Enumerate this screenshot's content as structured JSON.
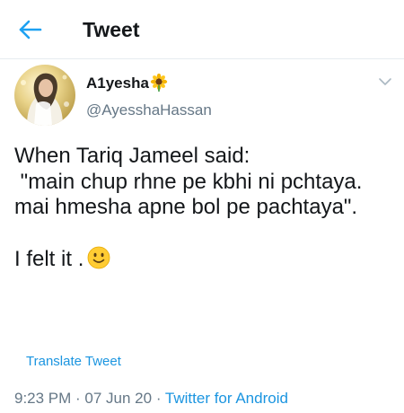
{
  "header": {
    "title": "Tweet",
    "back_icon": "arrow-left-icon",
    "accent": "#1da1f2"
  },
  "author": {
    "display_name": "A1yesha",
    "name_emoji": "sunflower-emoji",
    "handle": "@AyesshaHassan",
    "caret_icon": "chevron-down-icon"
  },
  "tweet": {
    "line1": "When Tariq Jameel said:",
    "line2": " \"main chup rhne pe kbhi ni pchtaya. mai hmesha apne bol pe pachtaya\".",
    "line3": "I felt it .",
    "end_emoji": "slightly-smiling-face-emoji"
  },
  "translate_label": "Translate Tweet",
  "meta": {
    "time": "9:23 PM",
    "sep1": " · ",
    "date": "07 Jun 20",
    "sep2": " · ",
    "source": "Twitter for Android"
  },
  "colors": {
    "text": "#14171a",
    "muted": "#657786",
    "link": "#1b95e0",
    "divider": "#e6ecf0"
  }
}
